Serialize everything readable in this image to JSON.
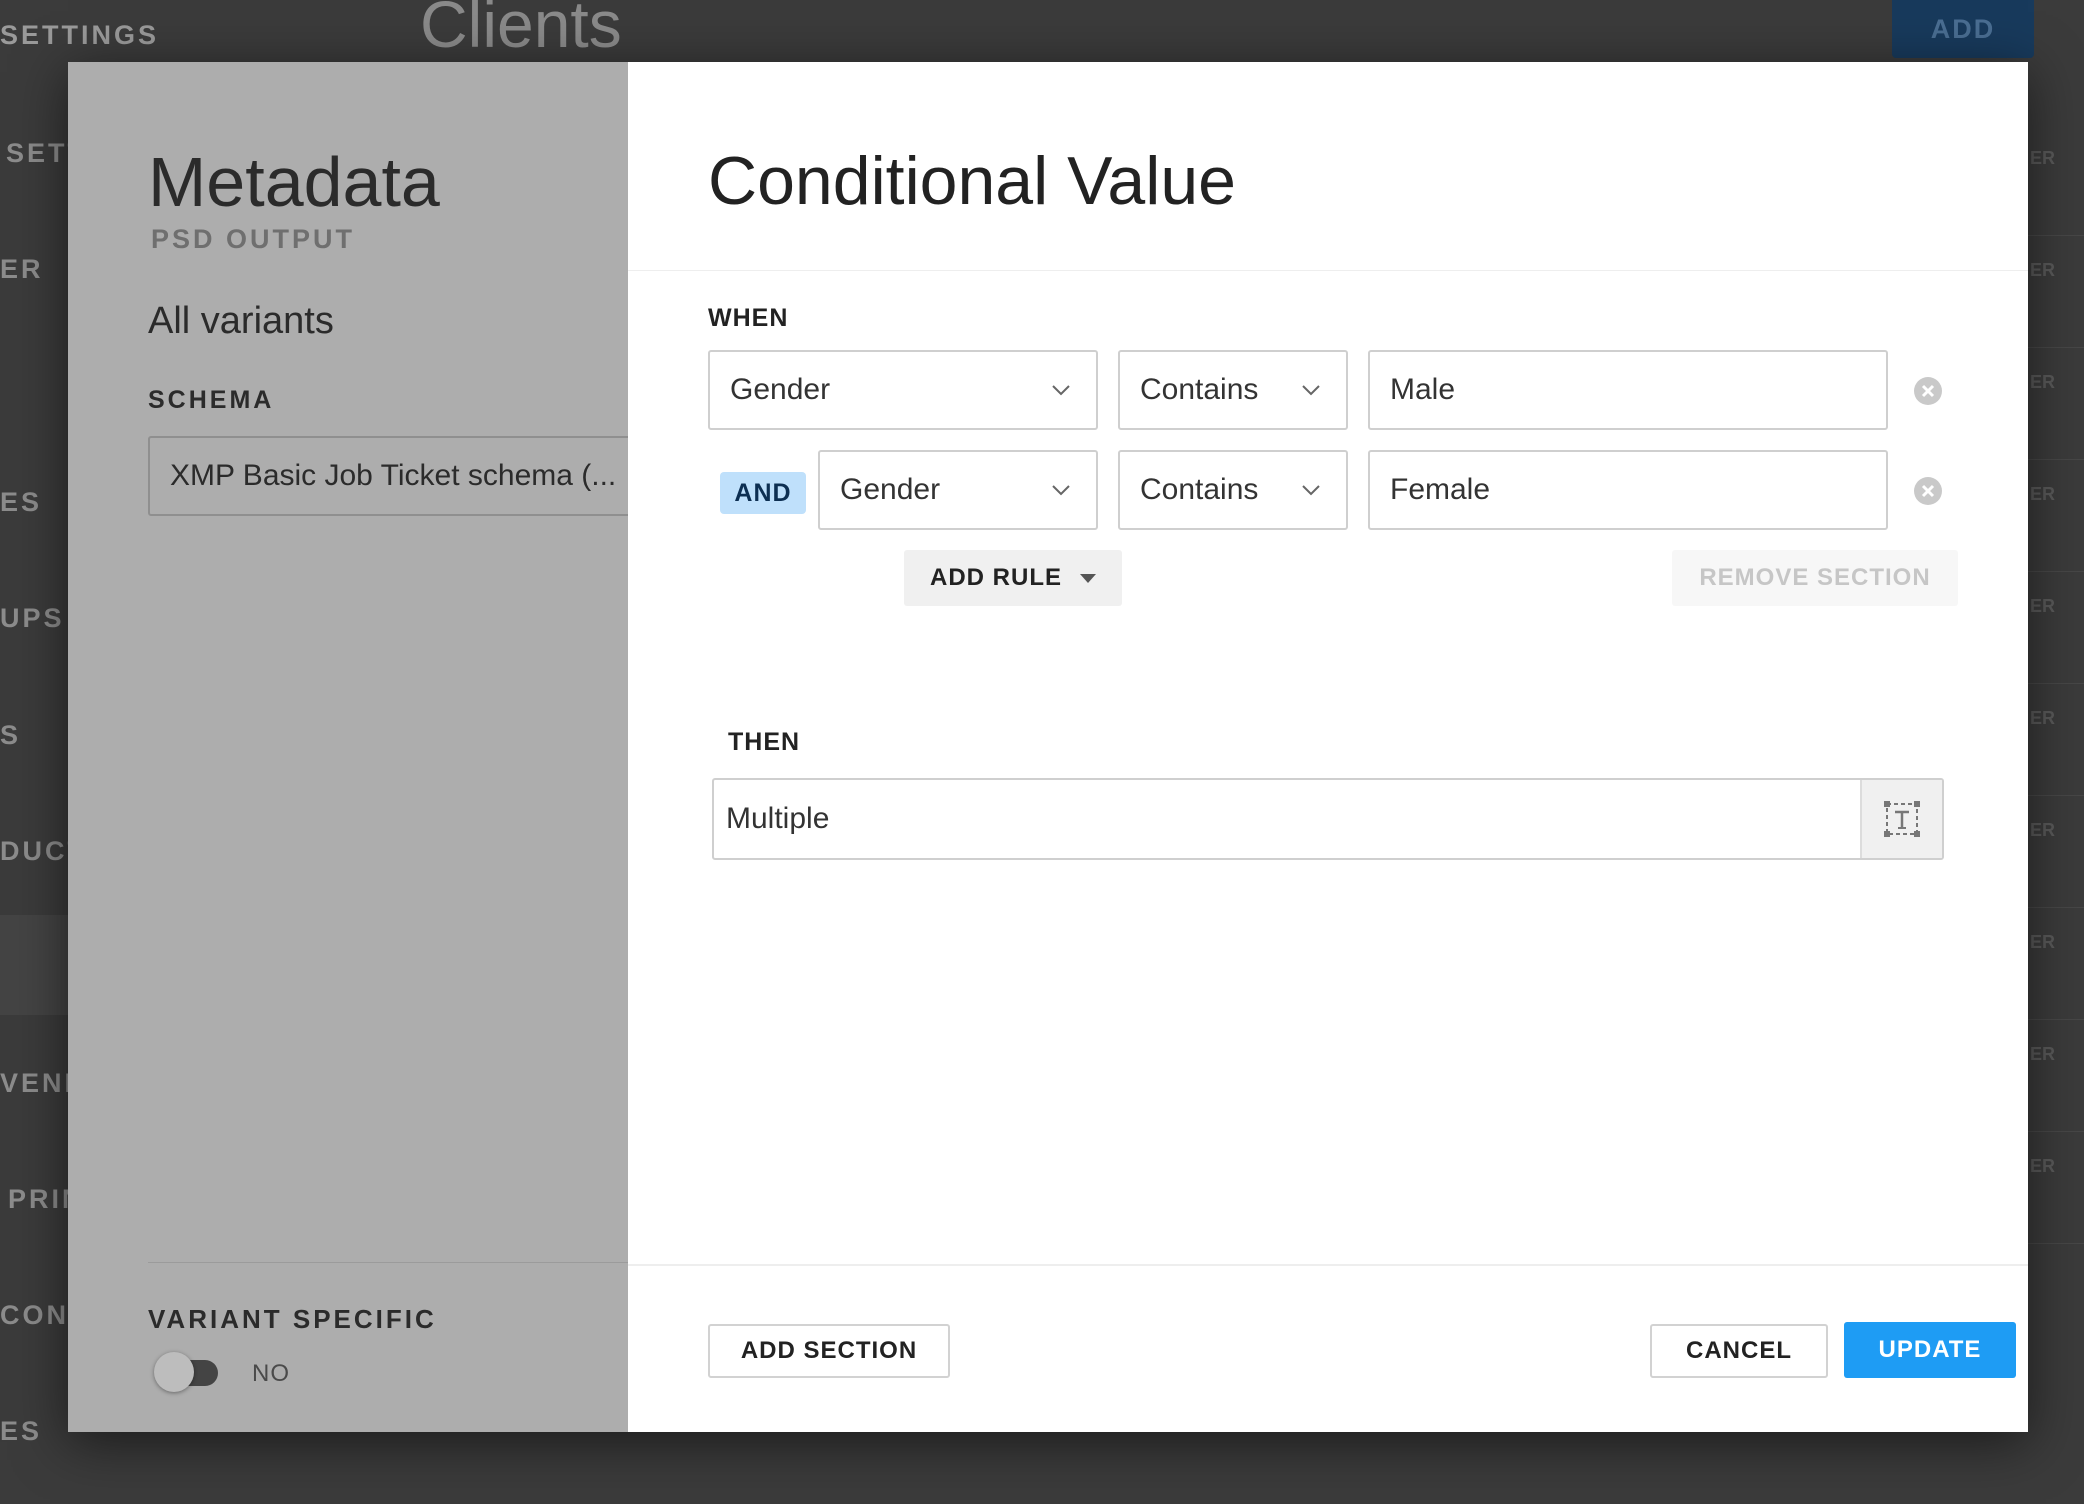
{
  "background": {
    "top_label": "SETTINGS",
    "page_title": "Clients",
    "add_button": "ADD",
    "nav_items": [
      {
        "label": "SETT"
      },
      {
        "label": "ER"
      },
      {
        "label": "ES"
      },
      {
        "label": "UPS"
      },
      {
        "label": "S"
      },
      {
        "label": "DUCT"
      },
      {
        "label": "VEND"
      },
      {
        "label": "PRIN"
      },
      {
        "label": "CONF"
      },
      {
        "label": "ES"
      }
    ],
    "row_labels": [
      "ER",
      "ER",
      "ER",
      "ER",
      "ER",
      "ER",
      "ER",
      "ER",
      "ER",
      "ER"
    ]
  },
  "left_panel": {
    "title": "Metadata",
    "subtitle": "PSD OUTPUT",
    "variants_heading": "All variants",
    "schema_label": "SCHEMA",
    "schema_value": "XMP Basic Job Ticket schema (...",
    "variant_specific_label": "VARIANT SPECIFIC",
    "variant_specific_value": "NO"
  },
  "dialog": {
    "title": "Conditional Value",
    "when_label": "WHEN",
    "rules": [
      {
        "connector": "",
        "field": "Gender",
        "operator": "Contains",
        "value": "Male"
      },
      {
        "connector": "AND",
        "field": "Gender",
        "operator": "Contains",
        "value": "Female"
      }
    ],
    "add_rule_label": "ADD RULE",
    "remove_section_label": "REMOVE SECTION",
    "then_label": "THEN",
    "then_value": "Multiple",
    "footer": {
      "add_section_label": "ADD SECTION",
      "cancel_label": "CANCEL",
      "update_label": "UPDATE"
    }
  },
  "colors": {
    "primary": "#1e9cf4",
    "and_badge_bg": "#bfe0fb",
    "overlay_panel": "#adadad"
  },
  "icons": {
    "dropdown": "chevron-down-icon",
    "remove": "close-circle-icon",
    "then_picker": "text-field-icon",
    "add_rule_caret": "caret-down-icon"
  }
}
